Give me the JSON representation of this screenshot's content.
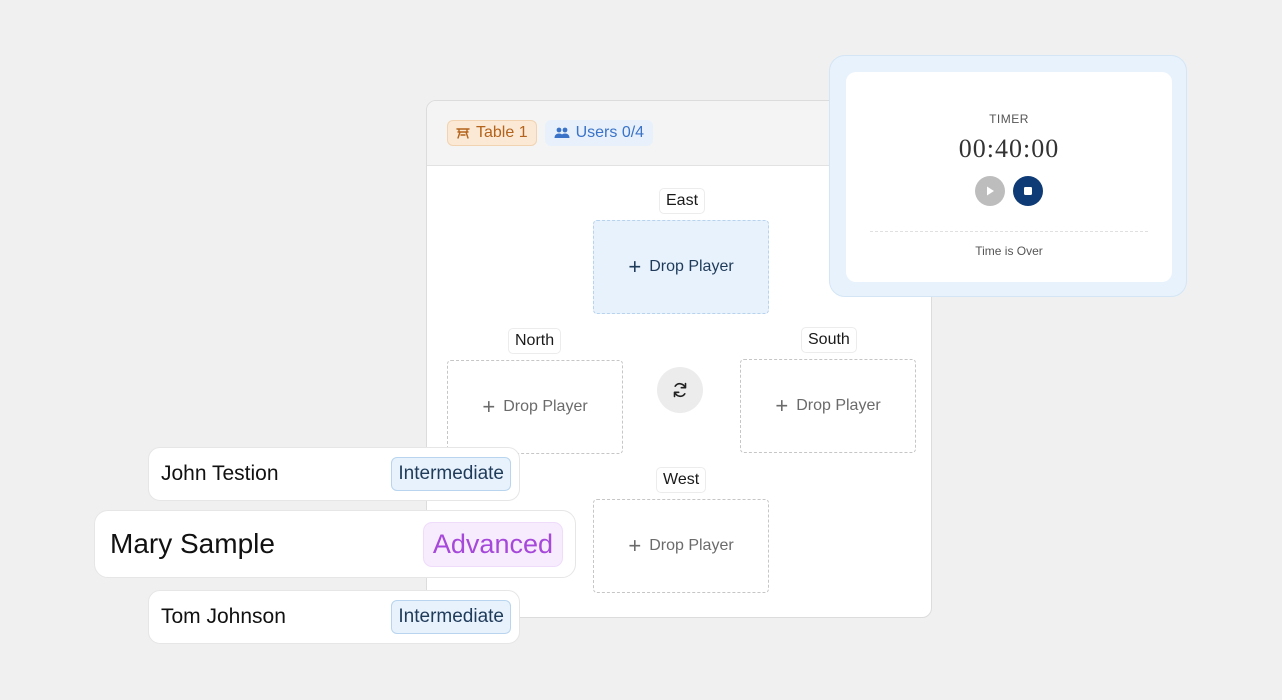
{
  "table": {
    "name": "Table 1",
    "users_label": "Users 0/4",
    "seats": [
      {
        "position": "East",
        "slot_label": "Drop Player",
        "active": true
      },
      {
        "position": "North",
        "slot_label": "Drop Player",
        "active": false
      },
      {
        "position": "South",
        "slot_label": "Drop Player",
        "active": false
      },
      {
        "position": "West",
        "slot_label": "Drop Player",
        "active": false
      }
    ]
  },
  "timer": {
    "title": "TIMER",
    "value": "00:40:00",
    "status": "Time is Over"
  },
  "players": [
    {
      "name": "John Testion",
      "level": "Intermediate"
    },
    {
      "name": "Mary Sample",
      "level": "Advanced"
    },
    {
      "name": "Tom Johnson",
      "level": "Intermediate"
    }
  ],
  "colors": {
    "background": "#f0f0f0",
    "table_pill": "#b3631b",
    "users_pill": "#3a73c8",
    "active_slot": "#e8f2fc",
    "stop_button": "#0e3a75",
    "advanced": "#a648d9"
  },
  "icons": [
    "table-icon",
    "users-icon",
    "plus-icon",
    "rotate-icon",
    "play-icon",
    "stop-icon"
  ]
}
